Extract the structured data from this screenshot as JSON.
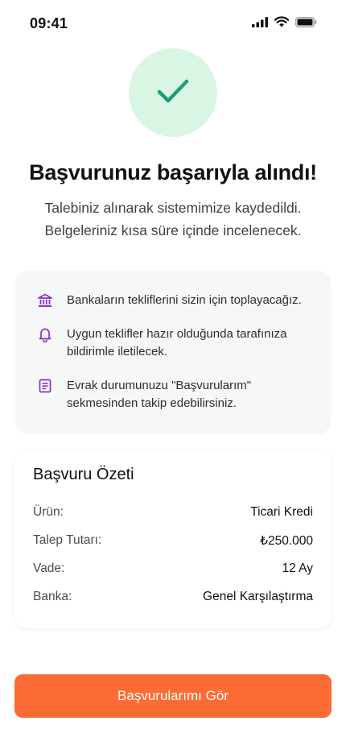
{
  "status_bar": {
    "time": "09:41",
    "icons": [
      "cellular-signal-icon",
      "wifi-icon",
      "battery-icon"
    ]
  },
  "success": {
    "icon": "checkmark-icon",
    "title": "Başvurunuz başarıyla alındı!",
    "subtitle_line1": "Talebiniz alınarak sistemimize kaydedildi.",
    "subtitle_line2": "Belgeleriniz kısa süre içinde incelenecek."
  },
  "info_items": [
    {
      "icon": "bank-icon",
      "text": "Bankaların tekliflerini sizin için toplayacağız."
    },
    {
      "icon": "bell-icon",
      "text": "Uygun teklifler hazır olduğunda tarafınıza bildirimle iletilecek."
    },
    {
      "icon": "document-icon",
      "text": "Evrak durumunuzu \"Başvurularım\" sekmesinden takip edebilirsiniz."
    }
  ],
  "summary": {
    "title": "Başvuru Özeti",
    "rows": [
      {
        "label": "Ürün:",
        "value": "Ticari Kredi"
      },
      {
        "label": "Talep Tutarı:",
        "value": "₺250.000"
      },
      {
        "label": "Vade:",
        "value": "12 Ay"
      },
      {
        "label": "Banka:",
        "value": "Genel Karşılaştırma"
      }
    ]
  },
  "cta": {
    "label": "Başvurularımı Gör"
  },
  "colors": {
    "accent": "#fb6b33",
    "success_bg": "#d9f6e4",
    "success_check": "#1f9e74",
    "info_icon": "#8b2fc9",
    "info_card_bg": "#f5f8f7"
  }
}
